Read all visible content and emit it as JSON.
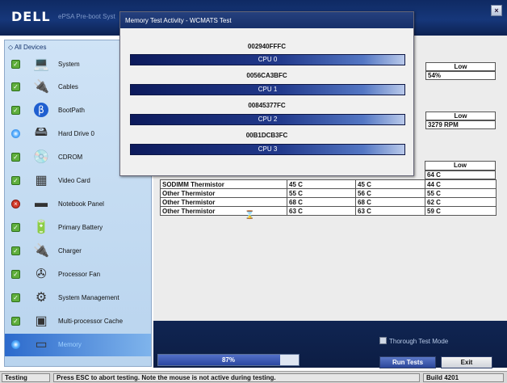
{
  "header": {
    "logo": "DELL",
    "title": "ePSA Pre-boot Syst",
    "close": "×"
  },
  "sidebar": {
    "all_devices": "All Devices",
    "items": [
      {
        "label": "System",
        "status": "ok",
        "icon": "laptop-icon"
      },
      {
        "label": "Cables",
        "status": "ok",
        "icon": "cables-icon"
      },
      {
        "label": "BootPath",
        "status": "ok",
        "icon": "bootpath-icon"
      },
      {
        "label": "Hard Drive 0",
        "status": "running",
        "icon": "hard-drive-icon"
      },
      {
        "label": "CDROM",
        "status": "ok",
        "icon": "cdrom-icon"
      },
      {
        "label": "Video Card",
        "status": "ok",
        "icon": "video-card-icon"
      },
      {
        "label": "Notebook Panel",
        "status": "error",
        "icon": "notebook-panel-icon"
      },
      {
        "label": "Primary Battery",
        "status": "ok",
        "icon": "battery-icon"
      },
      {
        "label": "Charger",
        "status": "ok",
        "icon": "charger-icon"
      },
      {
        "label": "Processor Fan",
        "status": "ok",
        "icon": "fan-icon"
      },
      {
        "label": "System Management",
        "status": "ok",
        "icon": "system-management-icon"
      },
      {
        "label": "Multi-processor Cache",
        "status": "ok",
        "icon": "cpu-cache-icon"
      },
      {
        "label": "Memory",
        "status": "running",
        "icon": "memory-icon"
      }
    ]
  },
  "content": {
    "group_low_1": {
      "header": "Low",
      "value": "54%"
    },
    "group_low_2": {
      "header": "Low",
      "value": "3279 RPM"
    },
    "group_low_3": {
      "header": "Low",
      "value": "64 C"
    },
    "thermistors": [
      [
        "SODIMM Thermistor",
        "45 C",
        "45 C",
        "44 C"
      ],
      [
        "Other Thermistor",
        "55 C",
        "56 C",
        "55 C"
      ],
      [
        "Other Thermistor",
        "68 C",
        "68 C",
        "62 C"
      ],
      [
        "Other Thermistor",
        "63 C",
        "63 C",
        "59 C"
      ]
    ]
  },
  "dialog": {
    "title": "Memory Test Activity - WCMATS Test",
    "rows": [
      {
        "address": "002940FFFC",
        "cpu": "CPU 0"
      },
      {
        "address": "0056CA3BFC",
        "cpu": "CPU 1"
      },
      {
        "address": "00845377FC",
        "cpu": "CPU 2"
      },
      {
        "address": "00B1DCB3FC",
        "cpu": "CPU 3"
      }
    ]
  },
  "controls": {
    "progress_label": "87%",
    "progress_value": 0.87,
    "thorough_label": "Thorough Test Mode",
    "run_label": "Run Tests",
    "exit_label": "Exit"
  },
  "statusbar": {
    "state": "Testing",
    "message": "Press ESC to abort testing.  Note the mouse is not active during testing.",
    "build": "Build  4201"
  }
}
